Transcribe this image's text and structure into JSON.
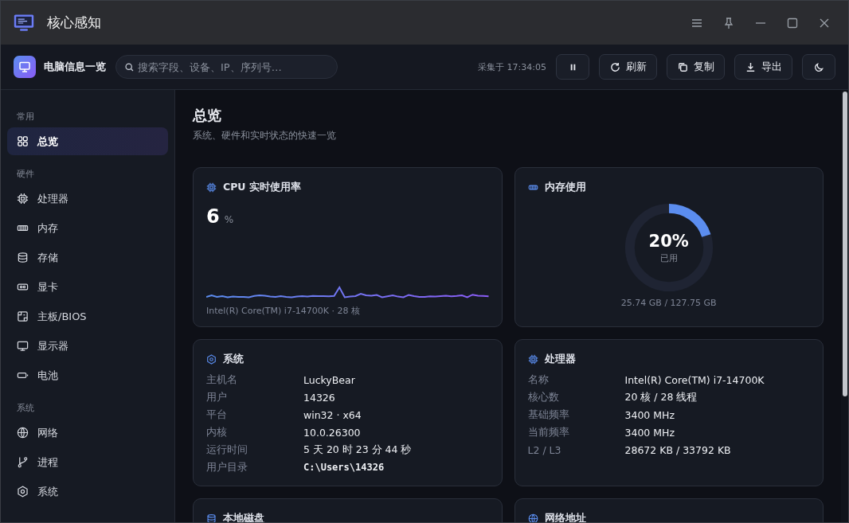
{
  "window": {
    "title": "核心感知"
  },
  "toolbar": {
    "title": "电脑信息一览",
    "search": {
      "placeholder": "搜索字段、设备、IP、序列号…"
    },
    "collected_at": "采集于 17:34:05",
    "buttons": [
      {
        "kind": "pause"
      },
      {
        "kind": "refresh",
        "label": "刷新"
      },
      {
        "kind": "copy",
        "label": "复制"
      },
      {
        "kind": "export",
        "label": "导出"
      },
      {
        "kind": "theme"
      }
    ]
  },
  "sidebar": {
    "groups": [
      {
        "label": "常用",
        "items": [
          {
            "label": "总览",
            "selected": true
          }
        ]
      },
      {
        "label": "硬件",
        "items": [
          {
            "label": "处理器",
            "selected": false
          },
          {
            "label": "内存",
            "selected": false
          },
          {
            "label": "存储",
            "selected": false
          },
          {
            "label": "显卡",
            "selected": false
          },
          {
            "label": "主板/BIOS",
            "selected": false
          },
          {
            "label": "显示器",
            "selected": false
          },
          {
            "label": "电池",
            "selected": false
          }
        ]
      },
      {
        "label": "系统",
        "items": [
          {
            "label": "网络",
            "selected": false
          },
          {
            "label": "进程",
            "selected": false
          },
          {
            "label": "系统",
            "selected": false
          }
        ]
      }
    ]
  },
  "page": {
    "title": "总览",
    "subtitle": "系统、硬件和实时状态的快速一览"
  },
  "cards": [
    {
      "kind": "cpu",
      "title": "CPU 实时使用率",
      "value": "6",
      "unit": "%",
      "footer": "Intel(R) Core(TM) i7-14700K · 28 核"
    },
    {
      "kind": "memory",
      "title": "内存使用",
      "level": 0.2,
      "percent": "20%",
      "caption": "已用",
      "footer": "25.74 GB / 127.75 GB"
    },
    {
      "kind": "info",
      "title": "系统",
      "rows": [
        {
          "label": "主机名",
          "value": "LuckyBear"
        },
        {
          "label": "用户",
          "value": "14326"
        },
        {
          "label": "平台",
          "value": "win32 · x64"
        },
        {
          "label": "内核",
          "value": "10.0.26300"
        },
        {
          "label": "运行时间",
          "value": "5 天 20 时 23 分 44 秒"
        },
        {
          "label": "用户目录",
          "value": "C:\\Users\\14326",
          "mono": true
        }
      ]
    },
    {
      "kind": "info",
      "title": "处理器",
      "rows": [
        {
          "label": "名称",
          "value": "Intel(R) Core(TM) i7-14700K"
        },
        {
          "label": "核心数",
          "value": "20 核 / 28 线程"
        },
        {
          "label": "基础频率",
          "value": "3400 MHz"
        },
        {
          "label": "当前频率",
          "value": "3400 MHz"
        },
        {
          "label": "L2 / L3",
          "value": "28672 KB / 33792 KB"
        }
      ]
    },
    {
      "kind": "info",
      "title": "本地磁盘"
    },
    {
      "kind": "info",
      "title": "网络地址"
    }
  ]
}
